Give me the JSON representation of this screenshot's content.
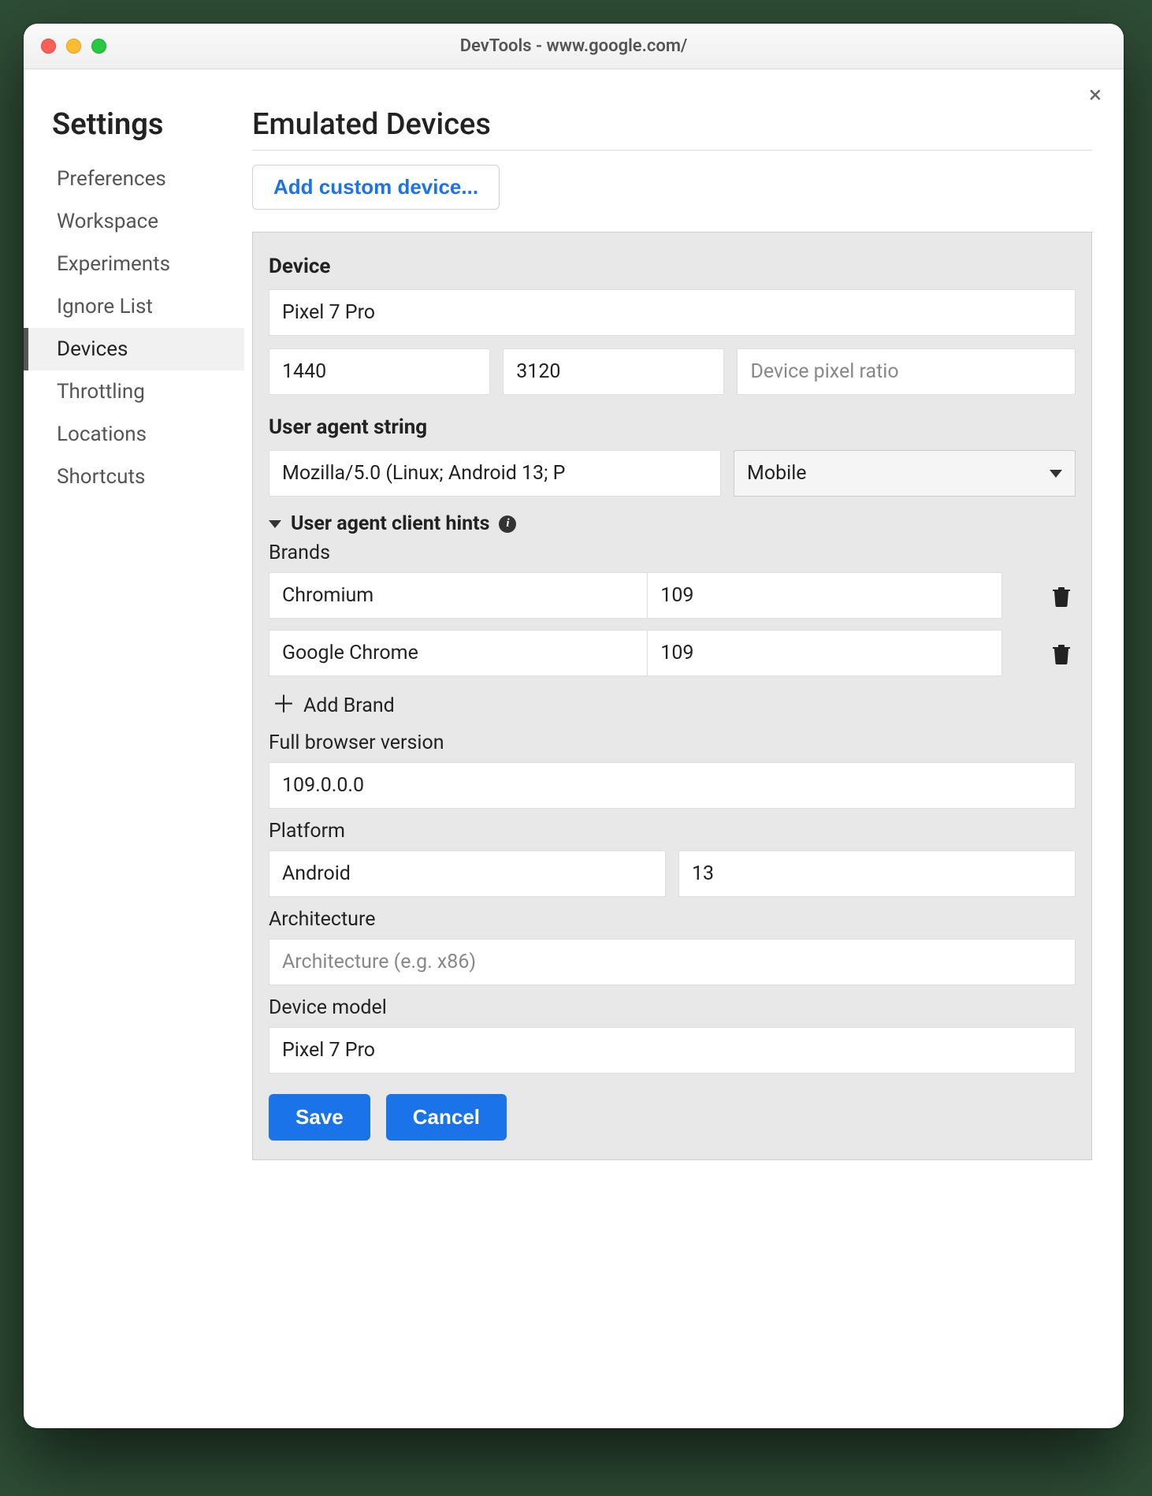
{
  "window": {
    "title": "DevTools - www.google.com/"
  },
  "sidebar": {
    "heading": "Settings",
    "items": [
      {
        "label": "Preferences"
      },
      {
        "label": "Workspace"
      },
      {
        "label": "Experiments"
      },
      {
        "label": "Ignore List"
      },
      {
        "label": "Devices",
        "active": true
      },
      {
        "label": "Throttling"
      },
      {
        "label": "Locations"
      },
      {
        "label": "Shortcuts"
      }
    ]
  },
  "main": {
    "heading": "Emulated Devices",
    "add_button": "Add custom device...",
    "device_section_label": "Device",
    "device_name": "Pixel 7 Pro",
    "width": "1440",
    "height": "3120",
    "dpr_placeholder": "Device pixel ratio",
    "ua_section_label": "User agent string",
    "ua_string": "Mozilla/5.0 (Linux; Android 13; P",
    "ua_type": "Mobile",
    "hints_label": "User agent client hints",
    "brands_label": "Brands",
    "brands": [
      {
        "name": "Chromium",
        "version": "109"
      },
      {
        "name": "Google Chrome",
        "version": "109"
      }
    ],
    "add_brand": "Add Brand",
    "full_version_label": "Full browser version",
    "full_version": "109.0.0.0",
    "platform_label": "Platform",
    "platform_name": "Android",
    "platform_version": "13",
    "arch_label": "Architecture",
    "arch_placeholder": "Architecture (e.g. x86)",
    "model_label": "Device model",
    "model": "Pixel 7 Pro",
    "save": "Save",
    "cancel": "Cancel"
  }
}
